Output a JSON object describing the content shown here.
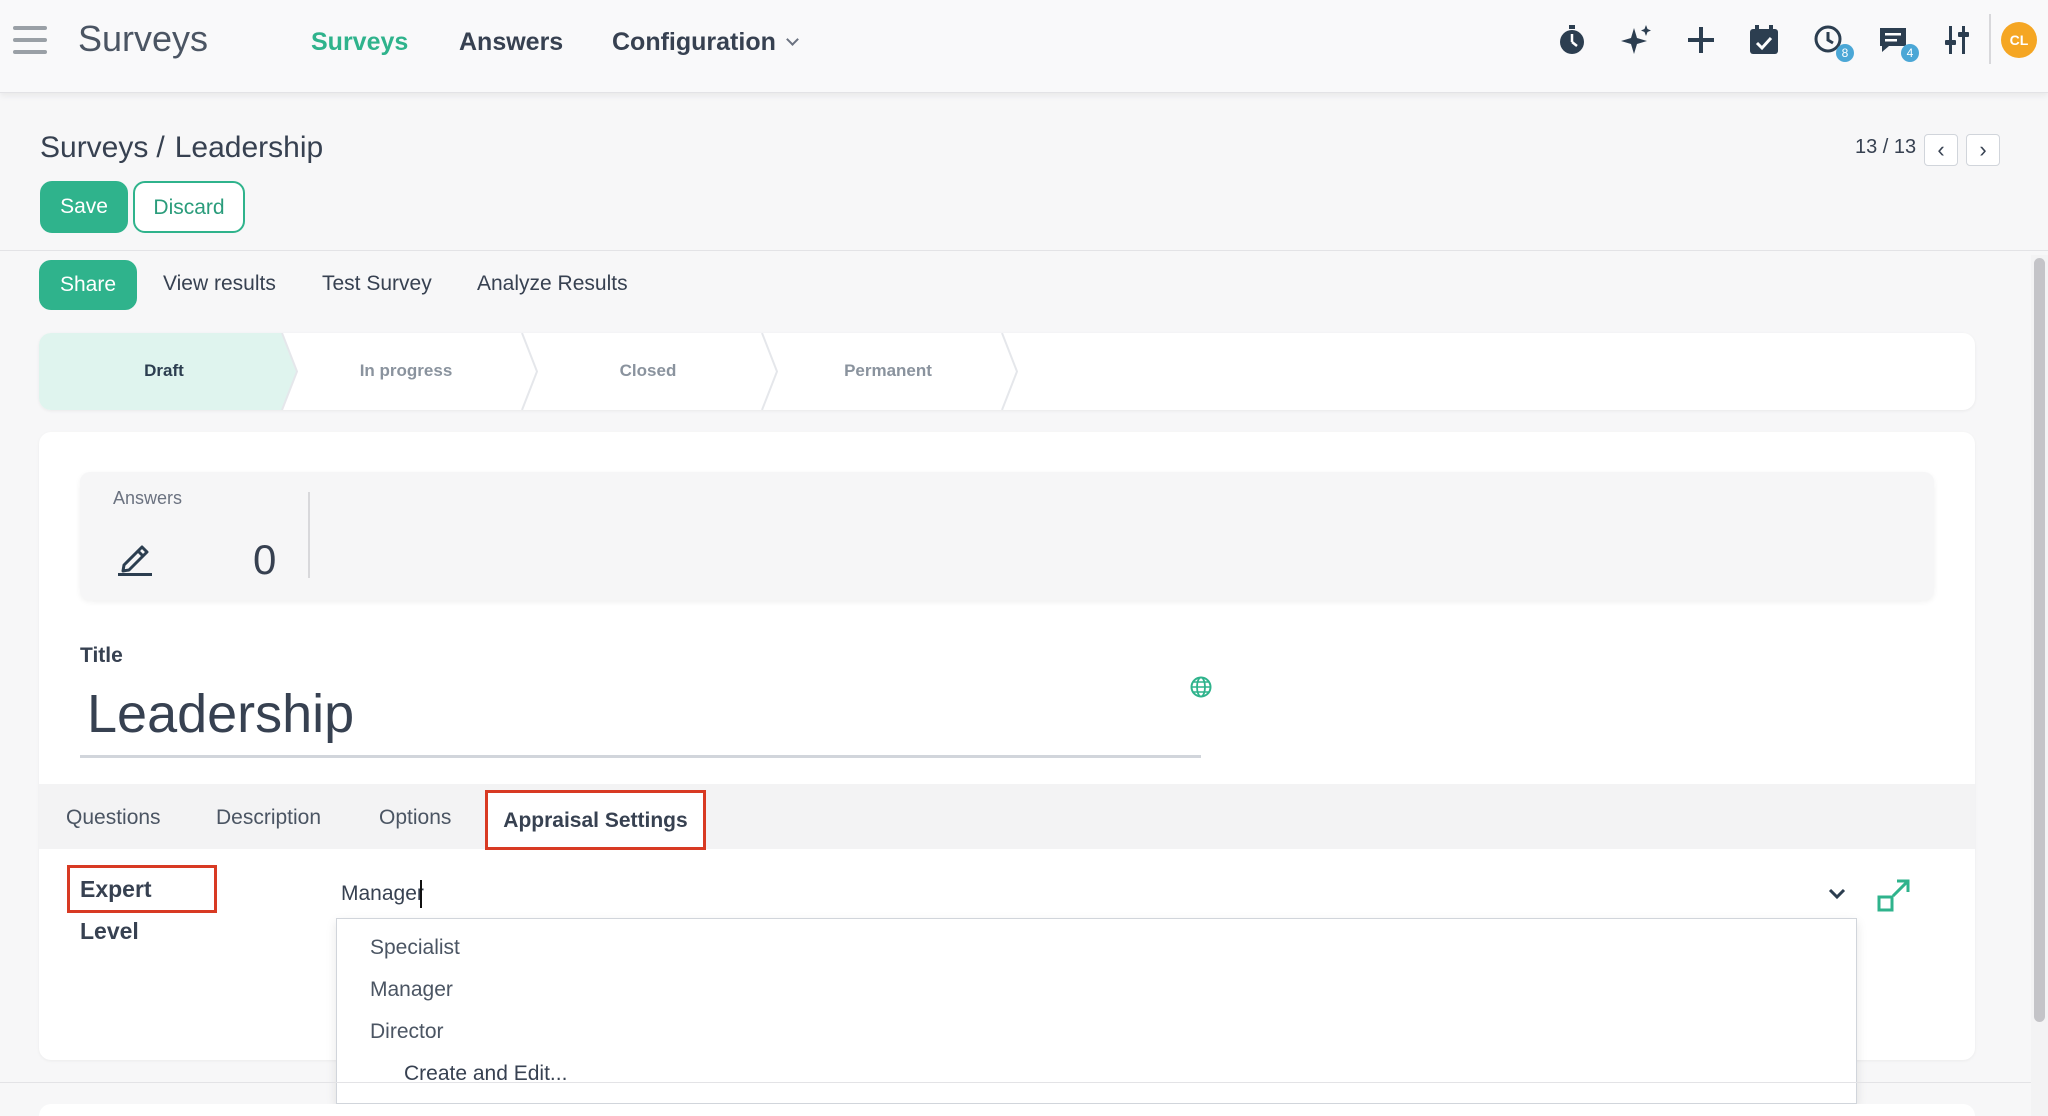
{
  "navbar": {
    "app_name": "Surveys",
    "menus": [
      {
        "label": "Surveys",
        "active": true
      },
      {
        "label": "Answers"
      },
      {
        "label": "Configuration"
      }
    ],
    "icons": [
      "stopwatch-icon",
      "sparkles-icon",
      "plus-icon",
      "calendar-check-icon",
      "clock-icon",
      "chat-icon",
      "settings-sliders-icon"
    ],
    "activity_badge": "8",
    "messages_badge": "4",
    "avatar_initials": "CL",
    "avatar_color": "#f5a623"
  },
  "breadcrumb": {
    "parent": "Surveys",
    "separator": "/",
    "current": "Leadership"
  },
  "actions": {
    "save_label": "Save",
    "discard_label": "Discard"
  },
  "pager": {
    "value": "13 / 13",
    "prev_symbol": "‹",
    "next_symbol": "›"
  },
  "statusbar": {
    "buttons": [
      "Share",
      "View results",
      "Test Survey",
      "Analyze Results"
    ],
    "stages": [
      "Draft",
      "In progress",
      "Closed",
      "Permanent"
    ],
    "active_stage": "Draft"
  },
  "stats": {
    "title": "Answers",
    "value": "0"
  },
  "form": {
    "title_label": "Title",
    "title_value": "Leadership"
  },
  "notebook": {
    "tabs": [
      "Questions",
      "Description",
      "Options",
      "Appraisal Settings"
    ],
    "active_tab": "Appraisal Settings"
  },
  "expert_level": {
    "label": "Expert Level",
    "value": "Manager",
    "options": [
      "Specialist",
      "Manager",
      "Director"
    ],
    "create_label": "Create and Edit..."
  },
  "colors": {
    "brand": "#2fb38c",
    "highlight": "#d83a23",
    "active_stage_bg": "#dff4ee"
  }
}
